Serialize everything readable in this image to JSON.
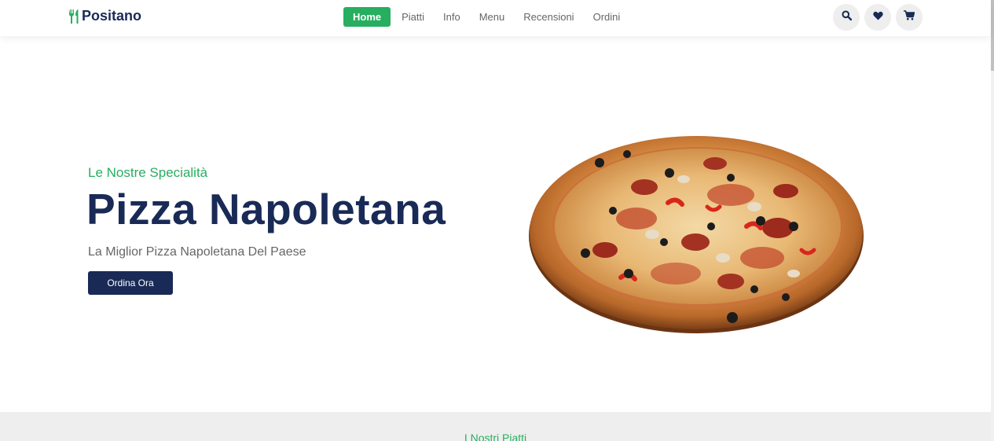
{
  "header": {
    "logo_text": "Positano",
    "nav": [
      {
        "label": "Home",
        "active": true
      },
      {
        "label": "Piatti",
        "active": false
      },
      {
        "label": "Info",
        "active": false
      },
      {
        "label": "Menu",
        "active": false
      },
      {
        "label": "Recensioni",
        "active": false
      },
      {
        "label": "Ordini",
        "active": false
      }
    ],
    "icons": [
      "search-icon",
      "heart-icon",
      "cart-icon"
    ]
  },
  "hero": {
    "subtitle": "Le Nostre Specialità",
    "title": "Pizza Napoletana",
    "tagline": "La Miglior Pizza Napoletana Del Paese",
    "cta_label": "Ordina Ora"
  },
  "section": {
    "heading": "I Nostri Piatti"
  },
  "colors": {
    "accent_green": "#27ae60",
    "navy": "#192a56",
    "muted_text": "#666666",
    "section_bg": "#eeeeee"
  }
}
